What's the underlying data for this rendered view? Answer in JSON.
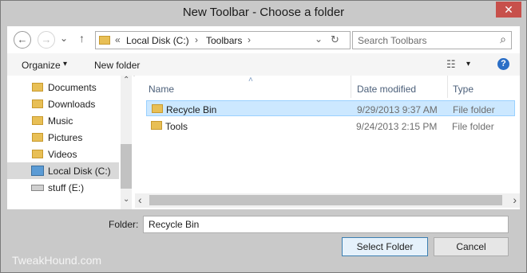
{
  "window": {
    "title": "New Toolbar - Choose a folder",
    "close_glyph": "✕"
  },
  "nav": {
    "back_glyph": "←",
    "forward_glyph": "→",
    "recent_glyph": "⌄",
    "up_glyph": "↑",
    "address": {
      "overflow": "«",
      "segments": [
        "Local Disk (C:)",
        "Toolbars"
      ],
      "separator": "›",
      "dropdown_glyph": "⌄",
      "refresh_glyph": "↻"
    },
    "search": {
      "placeholder": "Search Toolbars",
      "icon_glyph": "⌕"
    }
  },
  "commandbar": {
    "organize": "Organize",
    "organize_arrow": "▾",
    "new_folder": "New folder",
    "view_glyph": "☷",
    "view_arrow": "▾",
    "help_glyph": "?"
  },
  "navpane": {
    "items": [
      {
        "label": "Documents",
        "icon": "documents-folder-icon"
      },
      {
        "label": "Downloads",
        "icon": "downloads-folder-icon"
      },
      {
        "label": "Music",
        "icon": "music-folder-icon"
      },
      {
        "label": "Pictures",
        "icon": "pictures-folder-icon"
      },
      {
        "label": "Videos",
        "icon": "videos-folder-icon"
      },
      {
        "label": "Local Disk (C:)",
        "icon": "drive-icon",
        "selected": true
      },
      {
        "label": "stuff (E:)",
        "icon": "removable-drive-icon"
      }
    ],
    "scroll_up": "⌃",
    "scroll_down": "⌄"
  },
  "filelist": {
    "columns": {
      "name": "Name",
      "date": "Date modified",
      "type": "Type",
      "sort_glyph": "˄"
    },
    "rows": [
      {
        "name": "Recycle Bin",
        "date": "9/29/2013 9:37 AM",
        "type": "File folder",
        "selected": true
      },
      {
        "name": "Tools",
        "date": "9/24/2013 2:15 PM",
        "type": "File folder",
        "selected": false
      }
    ],
    "scroll_left": "‹",
    "scroll_right": "›"
  },
  "footer": {
    "folder_label": "Folder:",
    "folder_value": "Recycle Bin",
    "select_button": "Select Folder",
    "cancel_button": "Cancel",
    "watermark": "TweakHound.com"
  },
  "colors": {
    "selection": "#cce8ff",
    "selection_border": "#99d1ff",
    "close_button": "#c7504b",
    "folder": "#e8bf55",
    "header_text": "#4c607a"
  }
}
